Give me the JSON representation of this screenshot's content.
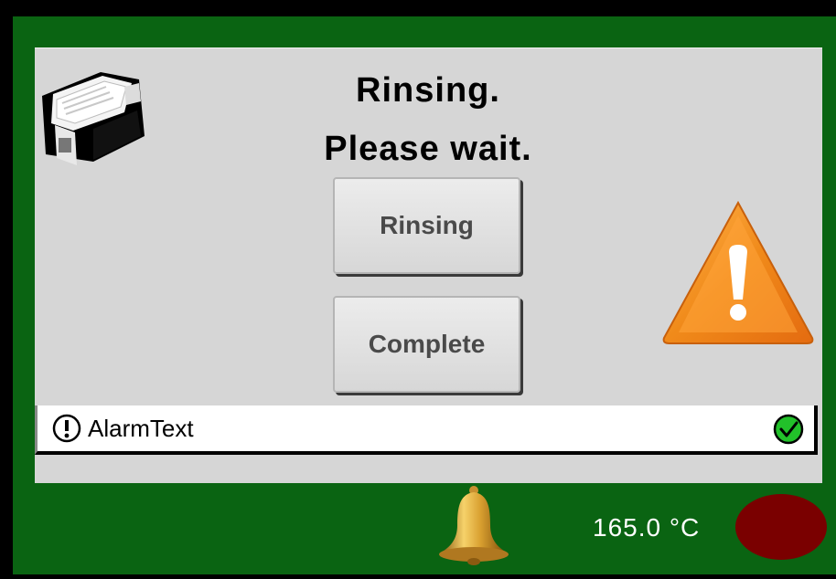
{
  "screen": {
    "title_line1": "Rinsing.",
    "title_line2": "Please wait."
  },
  "buttons": {
    "rinsing_label": "Rinsing",
    "complete_label": "Complete"
  },
  "alarm_bar": {
    "text": "AlarmText",
    "alarm_icon": "alarm-exclamation-icon",
    "status_icon": "ok-check-icon"
  },
  "status_bar": {
    "temperature": "165.0 °C",
    "bell_icon": "bell-icon",
    "lamp_color": "#7a0000"
  },
  "icons": {
    "device": "dispenser-device-icon",
    "warning": "warning-triangle-icon"
  },
  "colors": {
    "frame_green": "#0a6412",
    "panel_gray": "#d6d6d6",
    "warning_orange": "#f08a1a",
    "ok_green": "#22c12a"
  }
}
